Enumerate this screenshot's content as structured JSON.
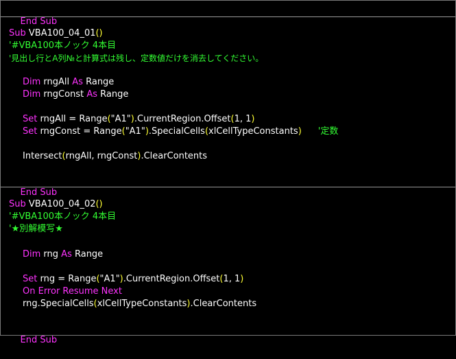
{
  "colors": {
    "background": "#000000",
    "keyword": "#ff33ff",
    "comment": "#33ff33",
    "paren": "#ffff33",
    "text": "#ffffff",
    "separator": "#9a9a9a"
  },
  "code": {
    "top_end_sub": "End Sub",
    "block1": {
      "sub_kw": "Sub",
      "sub_name": " VBA100_04_01",
      "sub_parens": "()",
      "comment1": "'#VBA100本ノック 4本目",
      "comment2": "'見出し行とA列№と計算式は残し、定数値だけを消去してください。",
      "dim1_kw": "Dim",
      "dim1_var": " rngAll ",
      "dim1_as": "As",
      "dim1_type": " Range",
      "dim2_kw": "Dim",
      "dim2_var": " rngConst ",
      "dim2_as": "As",
      "dim2_type": " Range",
      "set1_kw": "Set",
      "set1_a": " rngAll = Range",
      "set1_p1": "(",
      "set1_str": "\"A1\"",
      "set1_p2": ")",
      "set1_b": ".CurrentRegion.Offset",
      "set1_p3": "(",
      "set1_args": "1, 1",
      "set1_p4": ")",
      "set2_kw": "Set",
      "set2_a": " rngConst = Range",
      "set2_p1": "(",
      "set2_str": "\"A1\"",
      "set2_p2": ")",
      "set2_b": ".SpecialCells",
      "set2_p3": "(",
      "set2_args": "xlCellTypeConstants",
      "set2_p4": ")",
      "set2_comment": "'定数",
      "inter_a": "Intersect",
      "inter_p1": "(",
      "inter_args": "rngAll, rngConst",
      "inter_p2": ")",
      "inter_b": ".ClearContents",
      "end_sub": "End Sub"
    },
    "block2": {
      "sub_kw": "Sub",
      "sub_name": " VBA100_04_02",
      "sub_parens": "()",
      "comment1": "'#VBA100本ノック 4本目",
      "comment2": "'★別解模写★",
      "dim_kw": "Dim",
      "dim_var": " rng ",
      "dim_as": "As",
      "dim_type": " Range",
      "set_kw": "Set",
      "set_a": " rng = Range",
      "set_p1": "(",
      "set_str": "\"A1\"",
      "set_p2": ")",
      "set_b": ".CurrentRegion.Offset",
      "set_p3": "(",
      "set_args": "1, 1",
      "set_p4": ")",
      "onerror": "On Error Resume Next",
      "spec_a": "rng.SpecialCells",
      "spec_p1": "(",
      "spec_args": "xlCellTypeConstants",
      "spec_p2": ")",
      "spec_b": ".ClearContents",
      "end_sub": "End Sub"
    }
  }
}
